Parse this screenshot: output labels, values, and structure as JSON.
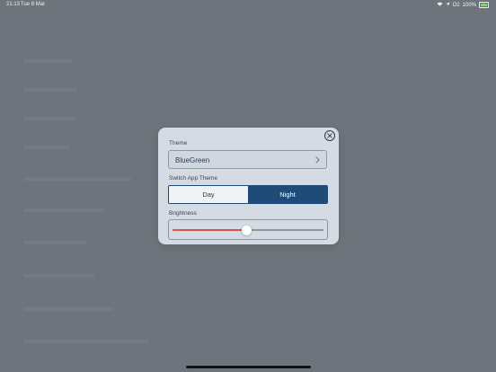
{
  "status_bar": {
    "time": "21:13",
    "date": "Tue 8 Mar",
    "carrier": "O2",
    "battery_percent": "100%",
    "battery_level": 1.0
  },
  "modal": {
    "theme_label": "Theme",
    "theme_value": "BlueGreen",
    "switch_label": "Switch App Theme",
    "segments": [
      "Day",
      "Night"
    ],
    "selected_segment": "Night",
    "brightness_label": "Brightness",
    "brightness_value": 0.49
  },
  "colors": {
    "backdrop": "#6e747b",
    "modal_bg": "#d4dbe3",
    "accent": "#1f4b79",
    "slider_fill": "#d9534f"
  }
}
